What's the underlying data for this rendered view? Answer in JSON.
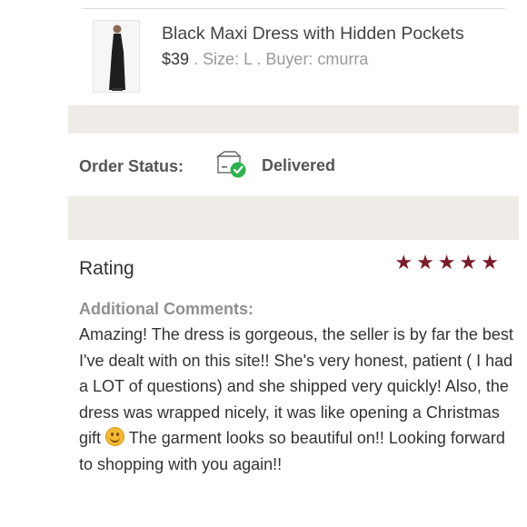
{
  "item": {
    "title": "Black Maxi Dress with Hidden Pockets",
    "price": "$39",
    "meta_rest": " . Size: L . Buyer: cmurra"
  },
  "order": {
    "status_label": "Order Status:",
    "status_value": "Delivered",
    "status_icon": "package-delivered-icon",
    "status_color": "#2bb24c"
  },
  "review": {
    "title": "Rating",
    "stars": 5,
    "star_color": "#7a1c2a",
    "comments_heading": "Additional Comments:",
    "comments_part1": "Amazing! The dress is gorgeous, the seller is by far the best I've dealt with on this site!! She's very honest, patient ( I had a LOT of questions) and she shipped very quickly! Also, the dress was wrapped nicely, it was like opening a Christmas gift ",
    "emoji": "smile-emoji",
    "comments_part2": " The garment looks so beautiful on!! Looking forward to shopping with you again!!"
  }
}
